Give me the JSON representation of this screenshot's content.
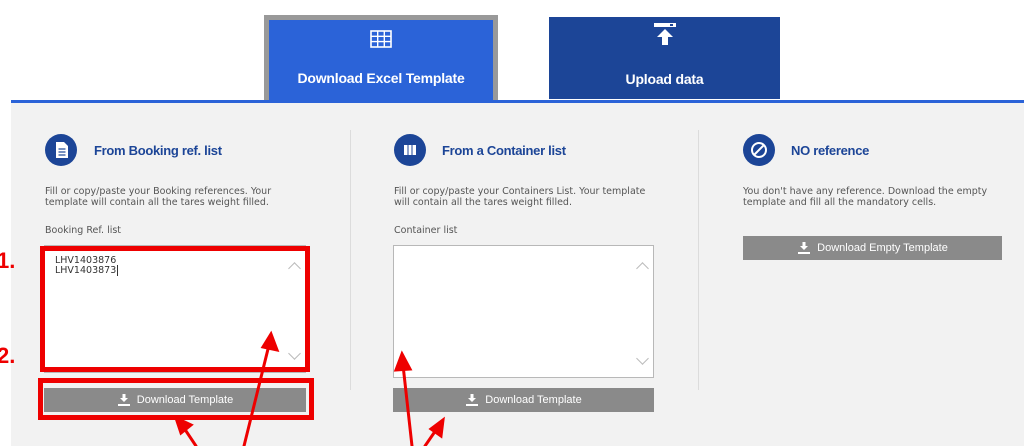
{
  "tabs": [
    {
      "label": "Download Excel Template",
      "icon": "table-grid-icon",
      "active": true
    },
    {
      "label": "Upload data",
      "icon": "upload-icon",
      "active": false
    }
  ],
  "sections": [
    {
      "title": "From Booking ref. list",
      "icon": "document-icon",
      "description": "Fill or copy/paste your Booking references. Your template will contain all the tares weight filled.",
      "field_label": "Booking Ref. list",
      "textarea_lines": [
        "LHV1403876",
        "LHV1403873"
      ],
      "button": "Download Template"
    },
    {
      "title": "From a Container list",
      "icon": "container-icon",
      "description": "Fill or copy/paste your Containers List. Your template will contain all the tares weight filled.",
      "field_label": "Container list",
      "textarea_lines": [],
      "button": "Download Template"
    },
    {
      "title": "NO reference",
      "icon": "no-entry-icon",
      "description": "You don't have any reference. Download the empty template and fill all the mandatory cells.",
      "button": "Download Empty Template"
    }
  ],
  "annotations": {
    "step1": "1.",
    "step2": "2."
  },
  "colors": {
    "active_tab": "#2b63d8",
    "inactive_tab": "#1c4597",
    "annotation_red": "#ee0000",
    "button_gray": "#8a8a8a"
  }
}
